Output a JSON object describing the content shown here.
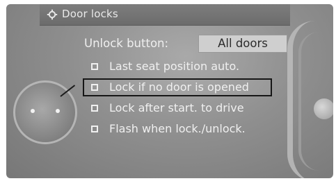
{
  "header": {
    "title": "Door locks",
    "icon": "gear-icon"
  },
  "settings": {
    "unlock_button": {
      "label": "Unlock button:",
      "value": "All doors"
    },
    "options": [
      {
        "label": "Last seat position auto.",
        "checked": false,
        "selected": false
      },
      {
        "label": "Lock if no door is opened",
        "checked": false,
        "selected": true
      },
      {
        "label": "Lock after start. to drive",
        "checked": false,
        "selected": false
      },
      {
        "label": "Flash when lock./unlock.",
        "checked": false,
        "selected": false
      }
    ]
  },
  "colors": {
    "screen": "#8f8f8f",
    "text": "#f0f0f0",
    "watermark": "#285ac8"
  }
}
